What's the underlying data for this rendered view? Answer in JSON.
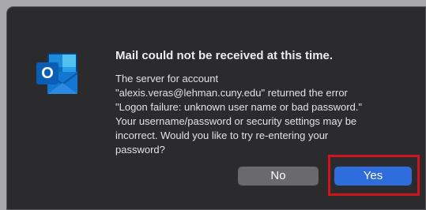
{
  "app": {
    "icon": "outlook-icon",
    "icon_letter": "O"
  },
  "dialog": {
    "title": "Mail could not be received at this time.",
    "message_lines": [
      "The server for account",
      "\"alexis.veras@lehman.cuny.edu\" returned the error",
      "\"Logon failure: unknown user name or bad password.\"",
      "Your username/password or security settings may be",
      "incorrect. Would you like to try re-entering your",
      "password?"
    ]
  },
  "buttons": {
    "no_label": "No",
    "yes_label": "Yes"
  },
  "colors": {
    "dialog_bg": "#2b2b2d",
    "primary_button": "#2f6ddc",
    "secondary_button": "#6a6a6c",
    "highlight": "#d0141b",
    "outlook_blue": "#0f6cbd"
  }
}
